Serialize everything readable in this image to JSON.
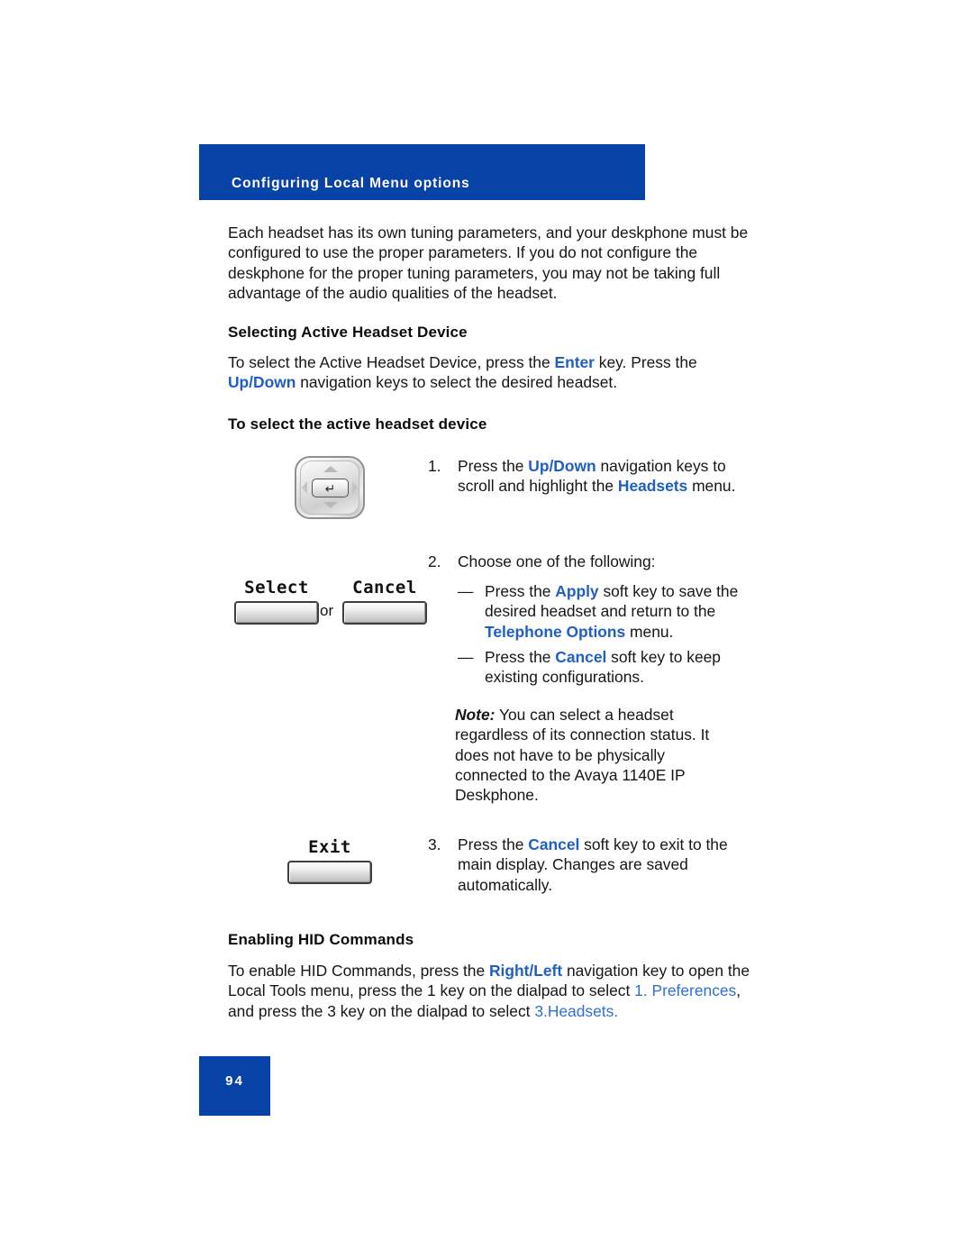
{
  "header": {
    "title": "Configuring Local Menu options",
    "band_color": "#0742A6"
  },
  "intro": {
    "paragraph": "Each headset has its own tuning parameters, and your deskphone must be configured to use the proper parameters. If you do not configure the deskphone for the proper tuning parameters, you may not be taking full advantage of the audio qualities of the headset."
  },
  "section_selecting": {
    "heading": "Selecting Active Headset Device",
    "intro_1": "To select the Active Headset Device, press the ",
    "key_enter": "Enter",
    "intro_2": " key. Press the ",
    "key_updown": "Up/Down",
    "intro_3": " navigation keys to select the desired headset.",
    "procedure_heading": "To select the active headset device"
  },
  "steps": {
    "step1": {
      "number": "1.",
      "text_1": "Press the ",
      "bold_blue_1": "Up/Down",
      "text_2": " navigation keys to scroll and highlight the ",
      "bold_blue_2": "Headsets",
      "text_3": " menu."
    },
    "step2": {
      "number": "2.",
      "text": "Choose one of the following:"
    },
    "bullet1": {
      "dash": "—",
      "text_1": "Press the ",
      "bold_blue_1": "Apply",
      "text_2": " soft key to save the desired headset and return to the ",
      "bold_blue_2": "Telephone Options",
      "text_3": " menu."
    },
    "bullet2": {
      "dash": "—",
      "text_1": "Press the ",
      "bold_blue_1": "Cancel",
      "text_2": " soft key to keep existing configurations."
    },
    "note": {
      "lead": "Note:",
      "text": " You can select a headset regardless of its connection status. It does not have to be physically connected to the Avaya 1140E IP Deskphone."
    },
    "step3": {
      "number": "3.",
      "text_1": "Press the ",
      "bold_blue_1": "Cancel",
      "text_2": " soft key to exit to the main display. Changes are saved automatically."
    }
  },
  "graphics": {
    "navigation_key": {
      "name": "navigation-key-cluster",
      "enter_glyph": "↵"
    },
    "softkey_select": "Select",
    "softkey_or": "or",
    "softkey_cancel": "Cancel",
    "softkey_exit": "Exit"
  },
  "section_hid": {
    "heading": "Enabling HID Commands",
    "text_1": "To enable HID Commands, press the ",
    "bold_blue_1": "Right/Left",
    "text_2": " navigation key to open the Local Tools menu, press the 1 key on the dialpad to select ",
    "link_1": "1. Preferences",
    "text_3": ", and press the 3 key on the dialpad to select ",
    "link_2": "3.Headsets."
  },
  "footer": {
    "page_number": "94"
  }
}
